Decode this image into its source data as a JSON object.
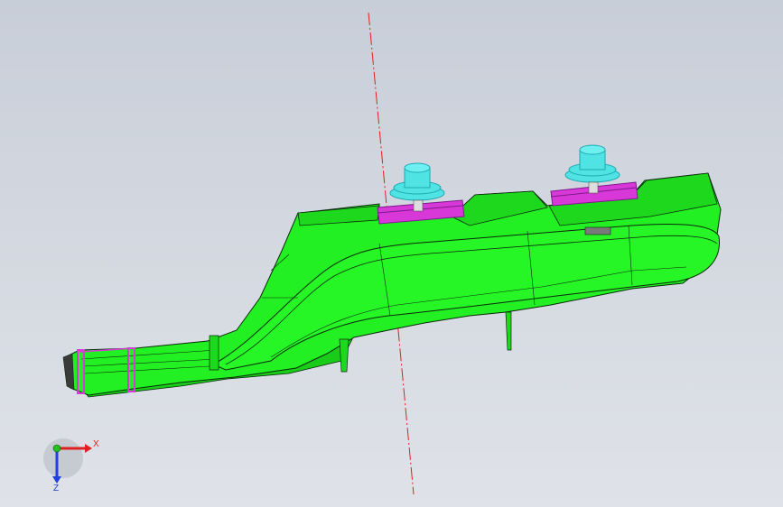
{
  "viewport": {
    "background_top": "#c8ced8",
    "background_bottom": "#dfe2e8"
  },
  "part": {
    "body_color": "#22f022",
    "edge_color": "#0a2a0a",
    "shadow_color": "#17c417"
  },
  "fasteners": {
    "bolt_color": "#4fe3e3",
    "bolt_dark": "#1fa9b4",
    "washer_color": "#d838d8",
    "washer_dark": "#7a1a8a",
    "count": 2
  },
  "axis_line": {
    "color": "#e02020",
    "style": "dash-dot"
  },
  "triad": {
    "x_label": "X",
    "z_label": "Z",
    "x_color": "#e02020",
    "y_color": "#22c022",
    "z_color": "#2040e0"
  }
}
